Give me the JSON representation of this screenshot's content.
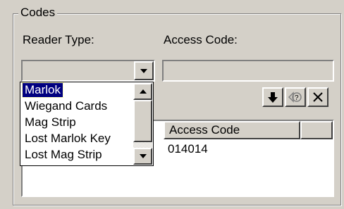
{
  "group": {
    "title": "Codes"
  },
  "reader_type": {
    "label": "Reader Type:",
    "value": "",
    "options": [
      "Marlok",
      "Wiegand Cards",
      "Mag Strip",
      "Lost Marlok Key",
      "Lost Mag Strip"
    ],
    "selected": "Marlok"
  },
  "access_code": {
    "label": "Access Code:",
    "value": ""
  },
  "toolbar": {
    "buttons": [
      {
        "name": "down-arrow-icon",
        "glyph": "↓"
      },
      {
        "name": "code-lookup-icon",
        "glyph": "?"
      },
      {
        "name": "delete-x-icon",
        "glyph": "✕"
      }
    ]
  },
  "table": {
    "columns": [
      "Access Code",
      ""
    ],
    "rows": [
      [
        "014014"
      ]
    ]
  },
  "colors": {
    "selection": "#000080",
    "face": "#d4d0c8"
  }
}
